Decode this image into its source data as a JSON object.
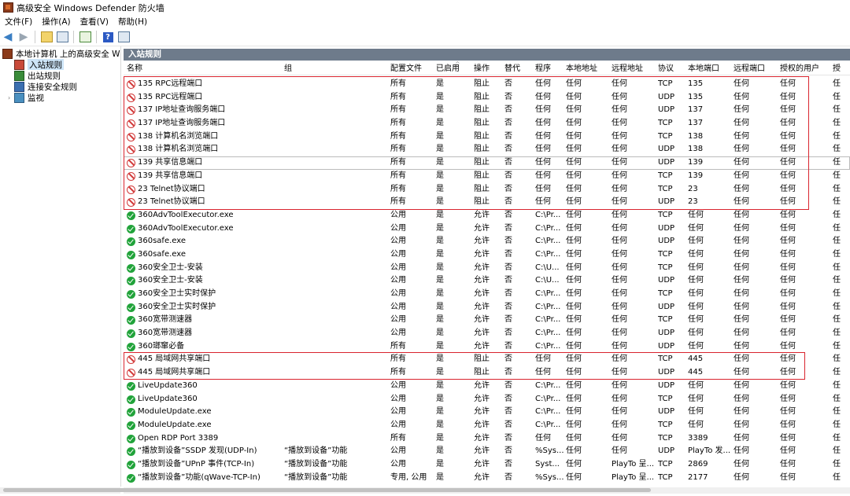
{
  "window": {
    "title": "高级安全 Windows Defender 防火墙"
  },
  "menu": [
    "文件(F)",
    "操作(A)",
    "查看(V)",
    "帮助(H)"
  ],
  "toolbar": {
    "icons": [
      "back-arrow-icon",
      "forward-arrow-icon",
      "up-folder-icon",
      "show-hide-tree-icon",
      "export-icon",
      "help-icon",
      "properties-icon"
    ]
  },
  "tree": {
    "root": "本地计算机 上的高级安全 Windows Defender 防火墙",
    "items": [
      "入站规则",
      "出站规则",
      "连接安全规则",
      "监视"
    ],
    "selected": "入站规则"
  },
  "panel": {
    "title": "入站规则"
  },
  "columns": [
    "名称",
    "组",
    "配置文件",
    "已启用",
    "操作",
    "替代",
    "程序",
    "本地地址",
    "远程地址",
    "协议",
    "本地端口",
    "远程端口",
    "授权的用户",
    "授"
  ],
  "rows": [
    {
      "status": "block",
      "name": "135 RPC远程端口",
      "group": "",
      "profile": "所有",
      "enabled": "是",
      "action": "阻止",
      "override": "否",
      "program": "任何",
      "local_addr": "任何",
      "remote_addr": "任何",
      "protocol": "TCP",
      "local_port": "135",
      "remote_port": "任何",
      "auth_users": "任何",
      "extra": "任"
    },
    {
      "status": "block",
      "name": "135 RPC远程端口",
      "group": "",
      "profile": "所有",
      "enabled": "是",
      "action": "阻止",
      "override": "否",
      "program": "任何",
      "local_addr": "任何",
      "remote_addr": "任何",
      "protocol": "UDP",
      "local_port": "135",
      "remote_port": "任何",
      "auth_users": "任何",
      "extra": "任"
    },
    {
      "status": "block",
      "name": "137 IP地址查询服务端口",
      "group": "",
      "profile": "所有",
      "enabled": "是",
      "action": "阻止",
      "override": "否",
      "program": "任何",
      "local_addr": "任何",
      "remote_addr": "任何",
      "protocol": "UDP",
      "local_port": "137",
      "remote_port": "任何",
      "auth_users": "任何",
      "extra": "任"
    },
    {
      "status": "block",
      "name": "137 IP地址查询服务端口",
      "group": "",
      "profile": "所有",
      "enabled": "是",
      "action": "阻止",
      "override": "否",
      "program": "任何",
      "local_addr": "任何",
      "remote_addr": "任何",
      "protocol": "TCP",
      "local_port": "137",
      "remote_port": "任何",
      "auth_users": "任何",
      "extra": "任"
    },
    {
      "status": "block",
      "name": "138 计算机名浏览端口",
      "group": "",
      "profile": "所有",
      "enabled": "是",
      "action": "阻止",
      "override": "否",
      "program": "任何",
      "local_addr": "任何",
      "remote_addr": "任何",
      "protocol": "TCP",
      "local_port": "138",
      "remote_port": "任何",
      "auth_users": "任何",
      "extra": "任"
    },
    {
      "status": "block",
      "name": "138 计算机名浏览端口",
      "group": "",
      "profile": "所有",
      "enabled": "是",
      "action": "阻止",
      "override": "否",
      "program": "任何",
      "local_addr": "任何",
      "remote_addr": "任何",
      "protocol": "UDP",
      "local_port": "138",
      "remote_port": "任何",
      "auth_users": "任何",
      "extra": "任"
    },
    {
      "status": "block",
      "name": "139 共享信息端口",
      "group": "",
      "profile": "所有",
      "enabled": "是",
      "action": "阻止",
      "override": "否",
      "program": "任何",
      "local_addr": "任何",
      "remote_addr": "任何",
      "protocol": "UDP",
      "local_port": "139",
      "remote_port": "任何",
      "auth_users": "任何",
      "extra": "任",
      "focused": true
    },
    {
      "status": "block",
      "name": "139 共享信息端口",
      "group": "",
      "profile": "所有",
      "enabled": "是",
      "action": "阻止",
      "override": "否",
      "program": "任何",
      "local_addr": "任何",
      "remote_addr": "任何",
      "protocol": "TCP",
      "local_port": "139",
      "remote_port": "任何",
      "auth_users": "任何",
      "extra": "任"
    },
    {
      "status": "block",
      "name": "23 Telnet协议端口",
      "group": "",
      "profile": "所有",
      "enabled": "是",
      "action": "阻止",
      "override": "否",
      "program": "任何",
      "local_addr": "任何",
      "remote_addr": "任何",
      "protocol": "TCP",
      "local_port": "23",
      "remote_port": "任何",
      "auth_users": "任何",
      "extra": "任"
    },
    {
      "status": "block",
      "name": "23 Telnet协议端口",
      "group": "",
      "profile": "所有",
      "enabled": "是",
      "action": "阻止",
      "override": "否",
      "program": "任何",
      "local_addr": "任何",
      "remote_addr": "任何",
      "protocol": "UDP",
      "local_port": "23",
      "remote_port": "任何",
      "auth_users": "任何",
      "extra": "任"
    },
    {
      "status": "allow",
      "name": "360AdvToolExecutor.exe",
      "group": "",
      "profile": "公用",
      "enabled": "是",
      "action": "允许",
      "override": "否",
      "program": "C:\\Pr...",
      "local_addr": "任何",
      "remote_addr": "任何",
      "protocol": "TCP",
      "local_port": "任何",
      "remote_port": "任何",
      "auth_users": "任何",
      "extra": "任"
    },
    {
      "status": "allow",
      "name": "360AdvToolExecutor.exe",
      "group": "",
      "profile": "公用",
      "enabled": "是",
      "action": "允许",
      "override": "否",
      "program": "C:\\Pr...",
      "local_addr": "任何",
      "remote_addr": "任何",
      "protocol": "UDP",
      "local_port": "任何",
      "remote_port": "任何",
      "auth_users": "任何",
      "extra": "任"
    },
    {
      "status": "allow",
      "name": "360safe.exe",
      "group": "",
      "profile": "公用",
      "enabled": "是",
      "action": "允许",
      "override": "否",
      "program": "C:\\Pr...",
      "local_addr": "任何",
      "remote_addr": "任何",
      "protocol": "UDP",
      "local_port": "任何",
      "remote_port": "任何",
      "auth_users": "任何",
      "extra": "任"
    },
    {
      "status": "allow",
      "name": "360safe.exe",
      "group": "",
      "profile": "公用",
      "enabled": "是",
      "action": "允许",
      "override": "否",
      "program": "C:\\Pr...",
      "local_addr": "任何",
      "remote_addr": "任何",
      "protocol": "TCP",
      "local_port": "任何",
      "remote_port": "任何",
      "auth_users": "任何",
      "extra": "任"
    },
    {
      "status": "allow",
      "name": "360安全卫士-安装",
      "group": "",
      "profile": "公用",
      "enabled": "是",
      "action": "允许",
      "override": "否",
      "program": "C:\\U...",
      "local_addr": "任何",
      "remote_addr": "任何",
      "protocol": "TCP",
      "local_port": "任何",
      "remote_port": "任何",
      "auth_users": "任何",
      "extra": "任"
    },
    {
      "status": "allow",
      "name": "360安全卫士-安装",
      "group": "",
      "profile": "公用",
      "enabled": "是",
      "action": "允许",
      "override": "否",
      "program": "C:\\U...",
      "local_addr": "任何",
      "remote_addr": "任何",
      "protocol": "UDP",
      "local_port": "任何",
      "remote_port": "任何",
      "auth_users": "任何",
      "extra": "任"
    },
    {
      "status": "allow",
      "name": "360安全卫士实时保护",
      "group": "",
      "profile": "公用",
      "enabled": "是",
      "action": "允许",
      "override": "否",
      "program": "C:\\Pr...",
      "local_addr": "任何",
      "remote_addr": "任何",
      "protocol": "TCP",
      "local_port": "任何",
      "remote_port": "任何",
      "auth_users": "任何",
      "extra": "任"
    },
    {
      "status": "allow",
      "name": "360安全卫士实时保护",
      "group": "",
      "profile": "公用",
      "enabled": "是",
      "action": "允许",
      "override": "否",
      "program": "C:\\Pr...",
      "local_addr": "任何",
      "remote_addr": "任何",
      "protocol": "UDP",
      "local_port": "任何",
      "remote_port": "任何",
      "auth_users": "任何",
      "extra": "任"
    },
    {
      "status": "allow",
      "name": "360宽带测速器",
      "group": "",
      "profile": "公用",
      "enabled": "是",
      "action": "允许",
      "override": "否",
      "program": "C:\\Pr...",
      "local_addr": "任何",
      "remote_addr": "任何",
      "protocol": "TCP",
      "local_port": "任何",
      "remote_port": "任何",
      "auth_users": "任何",
      "extra": "任"
    },
    {
      "status": "allow",
      "name": "360宽带测速器",
      "group": "",
      "profile": "公用",
      "enabled": "是",
      "action": "允许",
      "override": "否",
      "program": "C:\\Pr...",
      "local_addr": "任何",
      "remote_addr": "任何",
      "protocol": "UDP",
      "local_port": "任何",
      "remote_port": "任何",
      "auth_users": "任何",
      "extra": "任"
    },
    {
      "status": "allow",
      "name": "360瑯窜必备",
      "group": "",
      "profile": "所有",
      "enabled": "是",
      "action": "允许",
      "override": "否",
      "program": "C:\\Pr...",
      "local_addr": "任何",
      "remote_addr": "任何",
      "protocol": "UDP",
      "local_port": "任何",
      "remote_port": "任何",
      "auth_users": "任何",
      "extra": "任"
    },
    {
      "status": "block",
      "name": "445 局域网共享端口",
      "group": "",
      "profile": "所有",
      "enabled": "是",
      "action": "阻止",
      "override": "否",
      "program": "任何",
      "local_addr": "任何",
      "remote_addr": "任何",
      "protocol": "TCP",
      "local_port": "445",
      "remote_port": "任何",
      "auth_users": "任何",
      "extra": "任"
    },
    {
      "status": "block",
      "name": "445 局域网共享端口",
      "group": "",
      "profile": "所有",
      "enabled": "是",
      "action": "阻止",
      "override": "否",
      "program": "任何",
      "local_addr": "任何",
      "remote_addr": "任何",
      "protocol": "UDP",
      "local_port": "445",
      "remote_port": "任何",
      "auth_users": "任何",
      "extra": "任"
    },
    {
      "status": "allow",
      "name": "LiveUpdate360",
      "group": "",
      "profile": "公用",
      "enabled": "是",
      "action": "允许",
      "override": "否",
      "program": "C:\\Pr...",
      "local_addr": "任何",
      "remote_addr": "任何",
      "protocol": "UDP",
      "local_port": "任何",
      "remote_port": "任何",
      "auth_users": "任何",
      "extra": "任"
    },
    {
      "status": "allow",
      "name": "LiveUpdate360",
      "group": "",
      "profile": "公用",
      "enabled": "是",
      "action": "允许",
      "override": "否",
      "program": "C:\\Pr...",
      "local_addr": "任何",
      "remote_addr": "任何",
      "protocol": "TCP",
      "local_port": "任何",
      "remote_port": "任何",
      "auth_users": "任何",
      "extra": "任"
    },
    {
      "status": "allow",
      "name": "ModuleUpdate.exe",
      "group": "",
      "profile": "公用",
      "enabled": "是",
      "action": "允许",
      "override": "否",
      "program": "C:\\Pr...",
      "local_addr": "任何",
      "remote_addr": "任何",
      "protocol": "UDP",
      "local_port": "任何",
      "remote_port": "任何",
      "auth_users": "任何",
      "extra": "任"
    },
    {
      "status": "allow",
      "name": "ModuleUpdate.exe",
      "group": "",
      "profile": "公用",
      "enabled": "是",
      "action": "允许",
      "override": "否",
      "program": "C:\\Pr...",
      "local_addr": "任何",
      "remote_addr": "任何",
      "protocol": "TCP",
      "local_port": "任何",
      "remote_port": "任何",
      "auth_users": "任何",
      "extra": "任"
    },
    {
      "status": "allow",
      "name": "Open RDP Port 3389",
      "group": "",
      "profile": "所有",
      "enabled": "是",
      "action": "允许",
      "override": "否",
      "program": "任何",
      "local_addr": "任何",
      "remote_addr": "任何",
      "protocol": "TCP",
      "local_port": "3389",
      "remote_port": "任何",
      "auth_users": "任何",
      "extra": "任"
    },
    {
      "status": "allow",
      "name": "“播放到设备”SSDP 发现(UDP-In)",
      "group": "“播放到设备”功能",
      "profile": "公用",
      "enabled": "是",
      "action": "允许",
      "override": "否",
      "program": "%Sys...",
      "local_addr": "任何",
      "remote_addr": "任何",
      "protocol": "UDP",
      "local_port": "PlayTo 发...",
      "remote_port": "任何",
      "auth_users": "任何",
      "extra": "任"
    },
    {
      "status": "allow",
      "name": "“播放到设备”UPnP 事件(TCP-In)",
      "group": "“播放到设备”功能",
      "profile": "公用",
      "enabled": "是",
      "action": "允许",
      "override": "否",
      "program": "Syst...",
      "local_addr": "任何",
      "remote_addr": "PlayTo 呈...",
      "protocol": "TCP",
      "local_port": "2869",
      "remote_port": "任何",
      "auth_users": "任何",
      "extra": "任"
    },
    {
      "status": "allow",
      "name": "“播放到设备”功能(qWave-TCP-In)",
      "group": "“播放到设备”功能",
      "profile": "专用, 公用",
      "enabled": "是",
      "action": "允许",
      "override": "否",
      "program": "%Sys...",
      "local_addr": "任何",
      "remote_addr": "PlayTo 呈...",
      "protocol": "TCP",
      "local_port": "2177",
      "remote_port": "任何",
      "auth_users": "任何",
      "extra": "任"
    }
  ]
}
